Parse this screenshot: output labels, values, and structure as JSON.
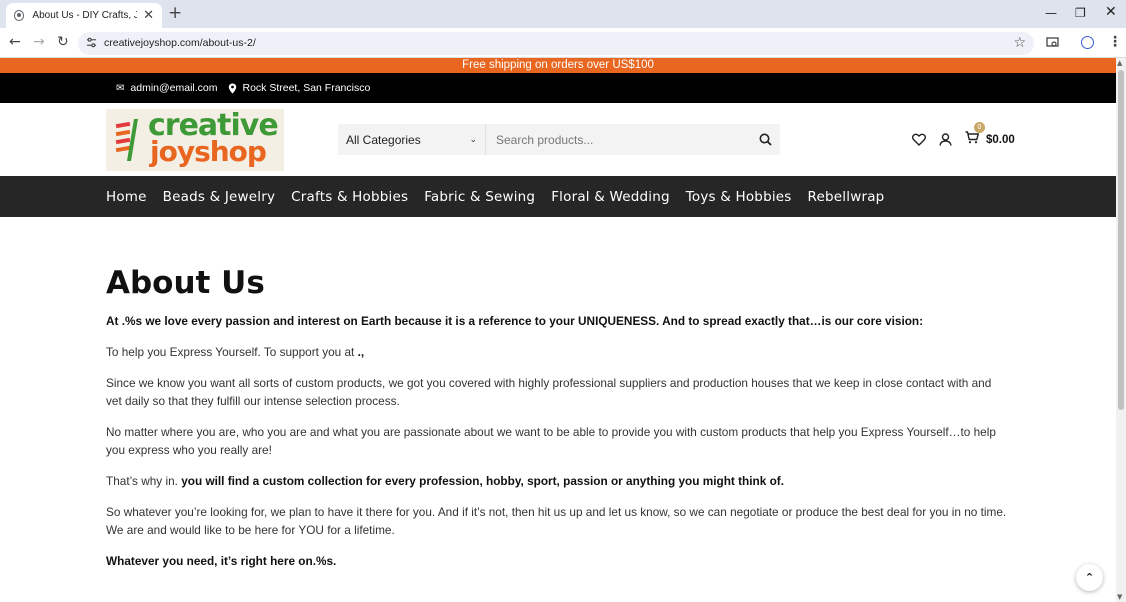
{
  "browser": {
    "tab_title": "About Us - DIY Crafts, Jewelry S",
    "tab_close": "✕",
    "new_tab": "+",
    "url": "creativejoyshop.com/about-us-2/",
    "window_min": "—",
    "window_max": "❐",
    "window_close": "✕"
  },
  "promo_bar": {
    "text": "Free shipping on orders over US$100"
  },
  "top_info": {
    "email": "admin@email.com",
    "address": "Rock Street, San Francisco"
  },
  "logo": {
    "line1": "creative",
    "line2": "joyshop"
  },
  "search": {
    "category": "All Categories",
    "placeholder": "Search products..."
  },
  "header_icons": {
    "wishlist": "wishlist-icon",
    "account": "user-icon",
    "cart": "cart-icon",
    "cart_count": "0",
    "cart_total": "$0.00"
  },
  "main_nav": {
    "items": [
      {
        "label": "Home"
      },
      {
        "label": "Beads & Jewelry"
      },
      {
        "label": "Crafts & Hobbies"
      },
      {
        "label": "Fabric & Sewing"
      },
      {
        "label": "Floral & Wedding"
      },
      {
        "label": "Toys & Hobbies"
      },
      {
        "label": "Rebellwrap"
      }
    ]
  },
  "content": {
    "title": "About Us",
    "p1": "At .%s we love every passion and interest on Earth because it is a reference to your UNIQUENESS. And to spread exactly that…is our core vision:",
    "p2_a": "To help you Express Yourself. To support you at ",
    "p2_b": ".,",
    "p3": "Since we know you want all sorts of custom products, we got you covered with highly professional suppliers and production houses that we keep in close contact with and vet daily so that they fulfill our intense selection process.",
    "p4": "No matter where you are, who you are and what you are passionate about we want to be able to provide you with custom products that help you Express Yourself…to help you express who you really are!",
    "p5_a": "That’s why in. ",
    "p5_b": "you will find a custom collection for every profession, hobby, sport, passion or anything you might think of.",
    "p6": "So whatever you’re looking for, we plan to have it there for you. And if it’s not, then hit us up and let us know, so we can negotiate or produce the best deal for you in no time. We are and would like to be here for YOU for a lifetime.",
    "p7": "Whatever you need, it’s right here on.%s."
  },
  "colors": {
    "promo": "#e8661f",
    "logo_green": "#3d9a36",
    "logo_orange": "#e8661f",
    "nav_bg": "#262626",
    "top_info_bg": "#000000"
  }
}
